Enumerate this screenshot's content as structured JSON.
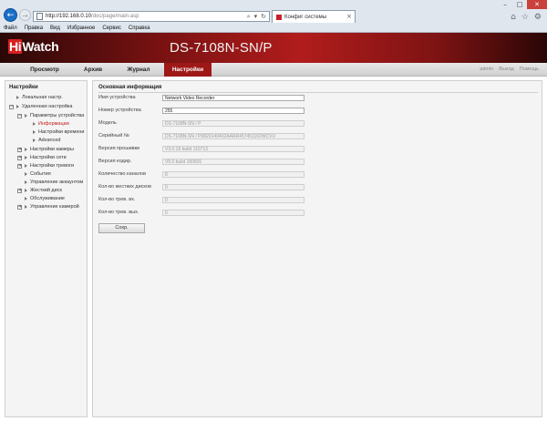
{
  "browser": {
    "url_host": "http://192.168.0.10",
    "url_path": "/doc/page/main.asp",
    "tab_title": "Конфиг системы",
    "menu": [
      "Файл",
      "Правка",
      "Вид",
      "Избранное",
      "Сервис",
      "Справка"
    ]
  },
  "app": {
    "logo_hi": "Hi",
    "logo_watch": "Watch",
    "model": "DS-7108N-SN/P"
  },
  "nav": {
    "items": [
      "Просмотр",
      "Архив",
      "Журнал",
      "Настройки"
    ],
    "active": "Настройки",
    "right": [
      "admin",
      "Выход",
      "Помощь"
    ]
  },
  "sidebar": {
    "title": "Настройки",
    "items": [
      {
        "label": "Локальная настр."
      },
      {
        "label": "Удаленная настройка"
      },
      {
        "label": "Параметры устройства"
      },
      {
        "label": "Информации"
      },
      {
        "label": "Настройки времени"
      },
      {
        "label": "Advanced"
      },
      {
        "label": "Настройки камеры"
      },
      {
        "label": "Настройки сети"
      },
      {
        "label": "Настройки тревоги"
      },
      {
        "label": "События"
      },
      {
        "label": "Управление аккаунтом"
      },
      {
        "label": "Жесткий диск"
      },
      {
        "label": "Обслуживание"
      },
      {
        "label": "Управление камерой"
      }
    ]
  },
  "main": {
    "section_title": "Основная информация",
    "fields": [
      {
        "label": "Имя устройства",
        "value": "Network Video Recorder",
        "editable": true
      },
      {
        "label": "Номер устройства",
        "value": "255",
        "editable": true
      },
      {
        "label": "Модель",
        "value": "DS-7108N-SN / P",
        "editable": false
      },
      {
        "label": "Серийный №",
        "value": "DS-7108N-SN / P0820140402AARR457451102WCVU",
        "editable": false
      },
      {
        "label": "Версия прошивки",
        "value": "V3.0.16 build 110713",
        "editable": false
      },
      {
        "label": "Версия кодир.",
        "value": "V5.0 build 150601",
        "editable": false
      },
      {
        "label": "Количество каналов",
        "value": "8",
        "editable": false
      },
      {
        "label": "Кол-во жестких дисков",
        "value": "0",
        "editable": false
      },
      {
        "label": "Кол-во трев. вх.",
        "value": "0",
        "editable": false
      },
      {
        "label": "Кол-во трев. вых.",
        "value": "0",
        "editable": false
      }
    ],
    "save_label": "Сохр."
  }
}
